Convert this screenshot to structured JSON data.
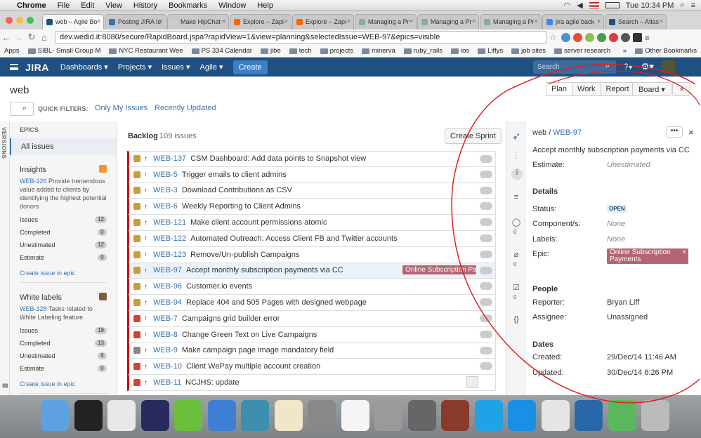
{
  "macbar": {
    "apple": "",
    "app": "Chrome",
    "menus": [
      "File",
      "Edit",
      "View",
      "History",
      "Bookmarks",
      "Window",
      "Help"
    ],
    "clock": "Tue 10:34 PM"
  },
  "tabs": [
    {
      "label": "web – Agile Bo",
      "color": "#205081",
      "active": true
    },
    {
      "label": "Posting JIRA Is",
      "color": "#3b73af"
    },
    {
      "label": "Make HipChat",
      "color": "#cccccc"
    },
    {
      "label": "Explore – Zapi",
      "color": "#ff6600"
    },
    {
      "label": "Explore – Zapi",
      "color": "#ff6600"
    },
    {
      "label": "Managing a Pr",
      "color": "#8aa"
    },
    {
      "label": "Managing a Pr",
      "color": "#8aa"
    },
    {
      "label": "Managing a Pr",
      "color": "#8aa"
    },
    {
      "label": "jira agile back",
      "color": "#4285f4"
    },
    {
      "label": "Search – Atlas",
      "color": "#205081"
    }
  ],
  "url": "dev.wedid.it:8080/secure/RapidBoard.jspa?rapidView=1&view=planning&selectedIssue=WEB-97&epics=visible",
  "bookmarks": [
    "Apps",
    "SIBL- Small Group M",
    "NYC Restaurant Wee",
    "PS 334 Calendar",
    "jibe",
    "tech",
    "projects",
    "minerva",
    "ruby_rails",
    "ios",
    "Liffys",
    "job sites",
    "server research",
    "»",
    "Other Bookmarks"
  ],
  "jira": {
    "logo": "JIRA",
    "menus": [
      "Dashboards ▾",
      "Projects ▾",
      "Issues ▾",
      "Agile ▾"
    ],
    "create": "Create",
    "search_placeholder": "Search"
  },
  "board": {
    "title": "web",
    "quick_filters_label": "QUICK FILTERS:",
    "filters": [
      "Only My Issues",
      "Recently Updated"
    ],
    "modes": [
      "Plan",
      "Work",
      "Report"
    ],
    "board_btn": "Board ▾",
    "collapse_btn": "«"
  },
  "versions_label": "VERSIONS",
  "epics": {
    "header": "EPICS",
    "all": "All issues",
    "list": [
      {
        "name": "Insights",
        "key": "WEB-126",
        "desc": "Provide tremendous value added to clients by identifying the highest potential donors",
        "color": "#f79232",
        "stats": [
          {
            "label": "Issues",
            "count": "12"
          },
          {
            "label": "Completed",
            "count": "0"
          },
          {
            "label": "Unestimated",
            "count": "12"
          },
          {
            "label": "Estimate",
            "count": "0"
          }
        ],
        "create": "Create issue in epic"
      },
      {
        "name": "White labels",
        "key": "WEB-128",
        "desc": "Tasks related to White Labeling feature",
        "color": "#815b3a",
        "stats": [
          {
            "label": "Issues",
            "count": "19"
          },
          {
            "label": "Completed",
            "count": "13"
          },
          {
            "label": "Unestimated",
            "count": "6"
          },
          {
            "label": "Estimate",
            "count": "0"
          }
        ],
        "create": "Create issue in epic"
      }
    ]
  },
  "backlog": {
    "title": "Backlog",
    "count": "109 issues",
    "create_sprint": "Create Sprint",
    "issues": [
      {
        "key": "WEB-137",
        "summary": "CSM Dashboard: Add data points to Snapshot view",
        "type": "story"
      },
      {
        "key": "WEB-5",
        "summary": "Trigger emails to client admins",
        "type": "story"
      },
      {
        "key": "WEB-3",
        "summary": "Download Contributions as CSV",
        "type": "story"
      },
      {
        "key": "WEB-6",
        "summary": "Weekly Reporting to Client Admins",
        "type": "story"
      },
      {
        "key": "WEB-121",
        "summary": "Make client account permissions atomic",
        "type": "story"
      },
      {
        "key": "WEB-122",
        "summary": "Automated Outreach: Access Client FB and Twitter accounts",
        "type": "story"
      },
      {
        "key": "WEB-123",
        "summary": "Remove/Un-publish Campaigns",
        "type": "story"
      },
      {
        "key": "WEB-97",
        "summary": "Accept monthly subscription payments via CC",
        "type": "story",
        "epic": "Online Subscription Payments",
        "selected": true
      },
      {
        "key": "WEB-96",
        "summary": "Customer.io events",
        "type": "story"
      },
      {
        "key": "WEB-94",
        "summary": "Replace 404 and 505 Pages with designed webpage",
        "type": "story"
      },
      {
        "key": "WEB-7",
        "summary": "Campaigns grid builder error",
        "type": "bug"
      },
      {
        "key": "WEB-8",
        "summary": "Change Green Text on Live Campaigns",
        "type": "bug"
      },
      {
        "key": "WEB-9",
        "summary": "Make campaign page image mandatory field",
        "type": "improvement"
      },
      {
        "key": "WEB-10",
        "summary": "Client WePay multiple account creation",
        "type": "bug"
      },
      {
        "key": "WEB-11",
        "summary": "NCJHS: update",
        "type": "bug",
        "avatar": true
      }
    ]
  },
  "detail": {
    "project": "web /",
    "key": "WEB-97",
    "summary": "Accept monthly subscription payments via CC",
    "estimate_label": "Estimate:",
    "estimate": "Unestimated",
    "details_hdr": "Details",
    "status_label": "Status:",
    "status": "OPEN",
    "components_label": "Component/s:",
    "components": "None",
    "labels_label": "Labels:",
    "labels": "None",
    "epic_label": "Epic:",
    "epic": "Online Subscription Payments",
    "people_hdr": "People",
    "reporter_label": "Reporter:",
    "reporter": "Bryan Liff",
    "assignee_label": "Assignee:",
    "assignee": "Unassigned",
    "dates_hdr": "Dates",
    "created_label": "Created:",
    "created": "29/Dec/14 11:46 AM",
    "updated_label": "Updated:",
    "updated": "30/Dec/14 6:26 PM",
    "comments": "0",
    "attachments": "0",
    "subtasks": "0"
  },
  "colors": {
    "jira_blue": "#205081",
    "link": "#3b73af",
    "priority_red": "#cc0000",
    "epic_label": "#b46572",
    "annotation": "#e02020"
  },
  "dock": [
    "finder",
    "terminal",
    "chrome",
    "eclipse",
    "brackets",
    "xcode",
    "quicksilver",
    "textedit",
    "calculator",
    "document",
    "system-preferences",
    "rocket",
    "photobooth",
    "skype",
    "teamviewer",
    "slack",
    "virtualbox",
    "sourcetree",
    "trash"
  ]
}
